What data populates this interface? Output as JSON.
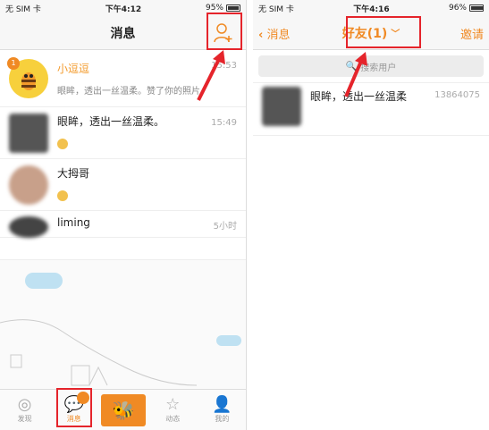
{
  "left": {
    "status": {
      "carrier": "无 SIM 卡",
      "time": "下午4:12",
      "battery": "95%"
    },
    "nav": {
      "title": "消息"
    },
    "conversations": [
      {
        "name": "小逗逗",
        "message": "眼眸，透出一丝温柔。赞了你的照片",
        "time": "15:53",
        "badge": "1"
      },
      {
        "name": "眼眸，透出一丝温柔。",
        "message": "",
        "time": "15:49"
      },
      {
        "name": "大拇哥",
        "message": "",
        "time": ""
      },
      {
        "name": "liming",
        "message": "",
        "time": "5小时"
      }
    ],
    "tabs": [
      {
        "label": "发现",
        "icon": "compass-icon"
      },
      {
        "label": "消息",
        "icon": "chat-icon",
        "badge": "1"
      },
      {
        "label": "",
        "icon": "bee-icon"
      },
      {
        "label": "动态",
        "icon": "star-icon"
      },
      {
        "label": "我的",
        "icon": "person-icon"
      }
    ]
  },
  "right": {
    "status": {
      "carrier": "无 SIM 卡",
      "time": "下午4:16",
      "battery": "96%"
    },
    "nav": {
      "back": "消息",
      "title": "好友(1)",
      "invite": "邀请"
    },
    "search": {
      "placeholder": "搜索用户"
    },
    "friends": [
      {
        "name": "眼眸，透出一丝温柔",
        "id": "13864075"
      }
    ]
  },
  "colors": {
    "accent": "#f08a24",
    "highlight": "#e5242b"
  }
}
